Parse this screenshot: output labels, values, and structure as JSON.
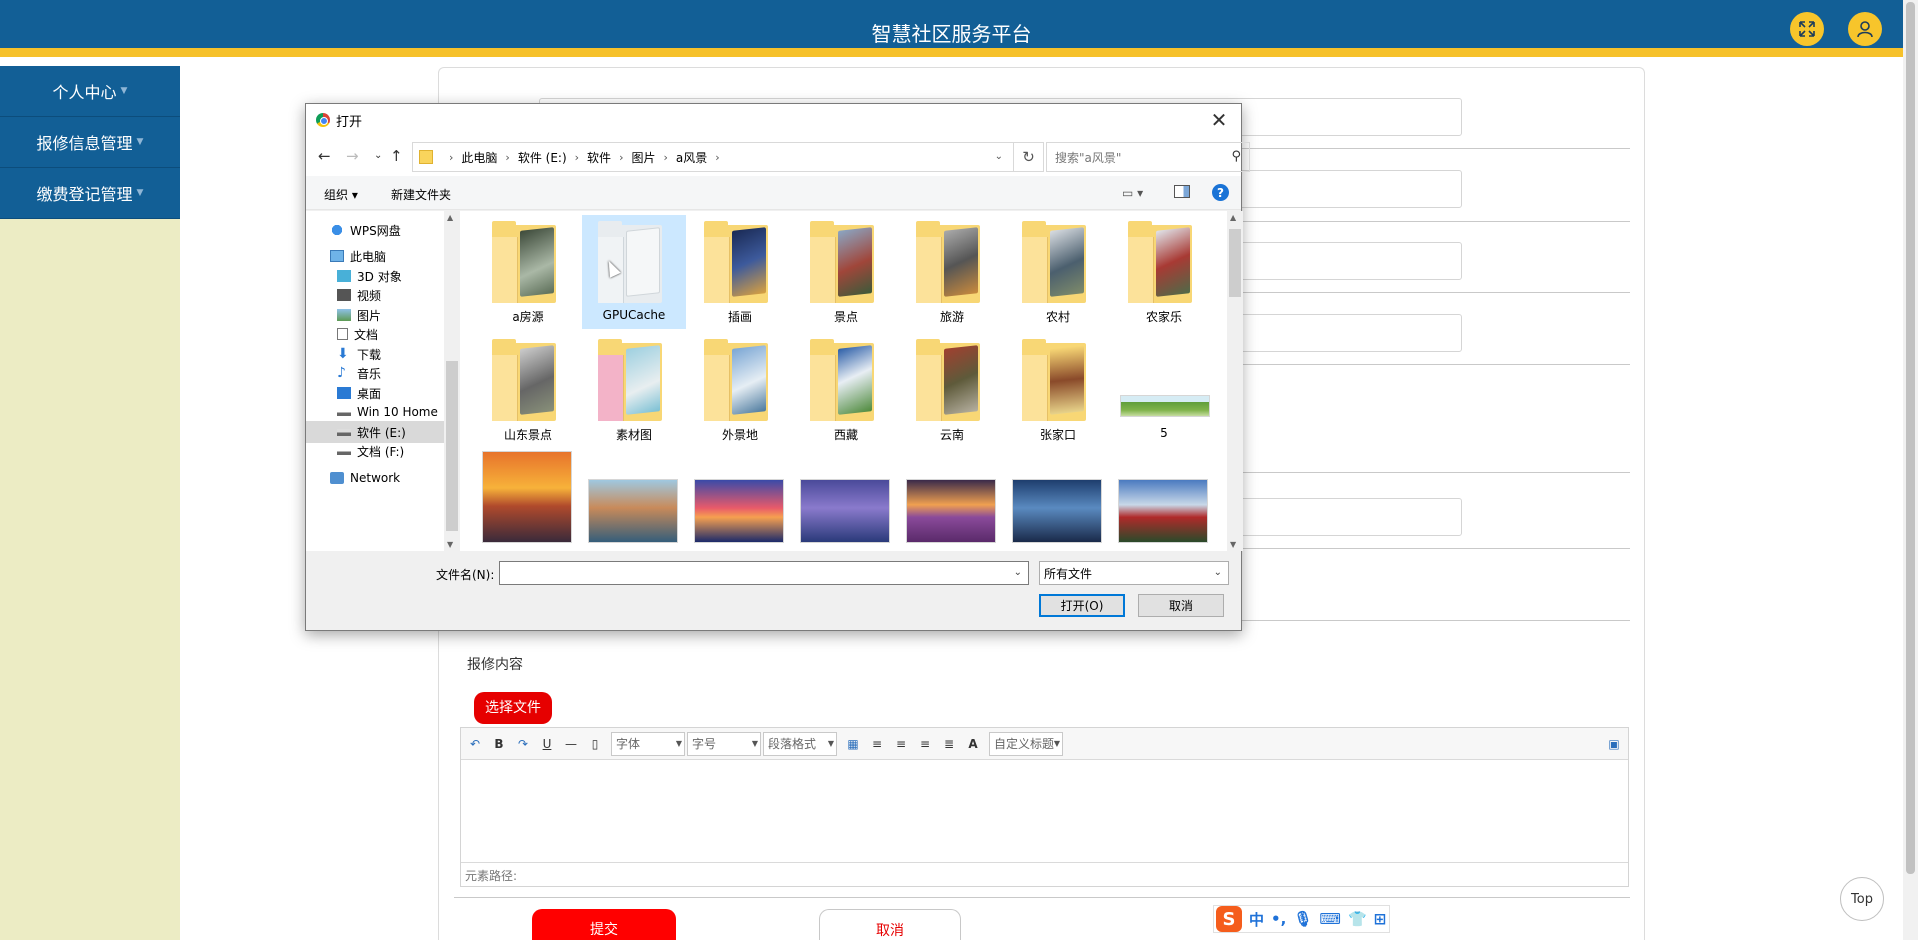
{
  "header": {
    "title": "智慧社区服务平台",
    "fullscreen_icon": "expand-arrows-icon",
    "user_icon": "user-icon",
    "accent": "#f6c12a",
    "brand": "#125f96"
  },
  "sidebar": {
    "items": [
      {
        "label": "个人中心"
      },
      {
        "label": "报修信息管理"
      },
      {
        "label": "缴费登记管理"
      }
    ]
  },
  "form": {
    "content_label": "报修内容",
    "choose_file": "选择文件",
    "editor": {
      "font_family": "字体",
      "font_size": "字号",
      "paragraph": "段落格式",
      "custom_title": "自定义标题",
      "element_path": "元素路径:",
      "bold": "B",
      "underline": "U",
      "font_color": "A"
    },
    "submit": "提交",
    "cancel": "取消"
  },
  "ime": {
    "logo": "S",
    "mode": "中",
    "punct": "•,"
  },
  "top_button": "Top",
  "dialog": {
    "title": "打开",
    "breadcrumb": [
      "此电脑",
      "软件 (E:)",
      "软件",
      "图片",
      "a风景"
    ],
    "search_placeholder": "搜索\"a风景\"",
    "organize": "组织",
    "new_folder": "新建文件夹",
    "help": "?",
    "tree": [
      {
        "label": "WPS网盘",
        "icon": "cloud-icon"
      },
      {
        "label": "此电脑",
        "icon": "computer-icon"
      },
      {
        "label": "3D 对象",
        "icon": "cube-icon"
      },
      {
        "label": "视频",
        "icon": "video-icon"
      },
      {
        "label": "图片",
        "icon": "picture-icon"
      },
      {
        "label": "文档",
        "icon": "document-icon"
      },
      {
        "label": "下载",
        "icon": "download-icon"
      },
      {
        "label": "音乐",
        "icon": "music-icon"
      },
      {
        "label": "桌面",
        "icon": "desktop-icon"
      },
      {
        "label": "Win 10 Home",
        "icon": "drive-icon"
      },
      {
        "label": "软件 (E:)",
        "icon": "drive-icon"
      },
      {
        "label": "文档 (F:)",
        "icon": "drive-icon"
      },
      {
        "label": "Network",
        "icon": "network-icon"
      }
    ],
    "files": [
      {
        "label": "a房源"
      },
      {
        "label": "GPUCache"
      },
      {
        "label": "插画"
      },
      {
        "label": "景点"
      },
      {
        "label": "旅游"
      },
      {
        "label": "农村"
      },
      {
        "label": "农家乐"
      },
      {
        "label": "山东景点"
      },
      {
        "label": "素材图"
      },
      {
        "label": "外景地"
      },
      {
        "label": "西藏"
      },
      {
        "label": "云南"
      },
      {
        "label": "张家口"
      },
      {
        "label": "5"
      }
    ],
    "filename_label": "文件名(N):",
    "filename_value": "",
    "filetype": "所有文件",
    "open": "打开(O)",
    "cancel": "取消"
  }
}
